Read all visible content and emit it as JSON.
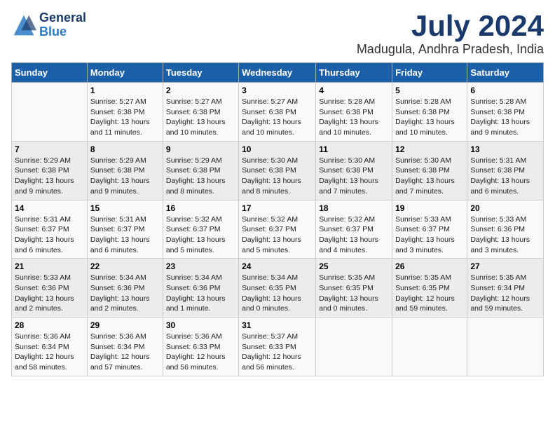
{
  "header": {
    "logo_line1": "General",
    "logo_line2": "Blue",
    "month": "July 2024",
    "location": "Madugula, Andhra Pradesh, India"
  },
  "columns": [
    "Sunday",
    "Monday",
    "Tuesday",
    "Wednesday",
    "Thursday",
    "Friday",
    "Saturday"
  ],
  "weeks": [
    [
      {
        "day": "",
        "info": ""
      },
      {
        "day": "1",
        "info": "Sunrise: 5:27 AM\nSunset: 6:38 PM\nDaylight: 13 hours\nand 11 minutes."
      },
      {
        "day": "2",
        "info": "Sunrise: 5:27 AM\nSunset: 6:38 PM\nDaylight: 13 hours\nand 10 minutes."
      },
      {
        "day": "3",
        "info": "Sunrise: 5:27 AM\nSunset: 6:38 PM\nDaylight: 13 hours\nand 10 minutes."
      },
      {
        "day": "4",
        "info": "Sunrise: 5:28 AM\nSunset: 6:38 PM\nDaylight: 13 hours\nand 10 minutes."
      },
      {
        "day": "5",
        "info": "Sunrise: 5:28 AM\nSunset: 6:38 PM\nDaylight: 13 hours\nand 10 minutes."
      },
      {
        "day": "6",
        "info": "Sunrise: 5:28 AM\nSunset: 6:38 PM\nDaylight: 13 hours\nand 9 minutes."
      }
    ],
    [
      {
        "day": "7",
        "info": "Sunrise: 5:29 AM\nSunset: 6:38 PM\nDaylight: 13 hours\nand 9 minutes."
      },
      {
        "day": "8",
        "info": "Sunrise: 5:29 AM\nSunset: 6:38 PM\nDaylight: 13 hours\nand 9 minutes."
      },
      {
        "day": "9",
        "info": "Sunrise: 5:29 AM\nSunset: 6:38 PM\nDaylight: 13 hours\nand 8 minutes."
      },
      {
        "day": "10",
        "info": "Sunrise: 5:30 AM\nSunset: 6:38 PM\nDaylight: 13 hours\nand 8 minutes."
      },
      {
        "day": "11",
        "info": "Sunrise: 5:30 AM\nSunset: 6:38 PM\nDaylight: 13 hours\nand 7 minutes."
      },
      {
        "day": "12",
        "info": "Sunrise: 5:30 AM\nSunset: 6:38 PM\nDaylight: 13 hours\nand 7 minutes."
      },
      {
        "day": "13",
        "info": "Sunrise: 5:31 AM\nSunset: 6:38 PM\nDaylight: 13 hours\nand 6 minutes."
      }
    ],
    [
      {
        "day": "14",
        "info": "Sunrise: 5:31 AM\nSunset: 6:37 PM\nDaylight: 13 hours\nand 6 minutes."
      },
      {
        "day": "15",
        "info": "Sunrise: 5:31 AM\nSunset: 6:37 PM\nDaylight: 13 hours\nand 6 minutes."
      },
      {
        "day": "16",
        "info": "Sunrise: 5:32 AM\nSunset: 6:37 PM\nDaylight: 13 hours\nand 5 minutes."
      },
      {
        "day": "17",
        "info": "Sunrise: 5:32 AM\nSunset: 6:37 PM\nDaylight: 13 hours\nand 5 minutes."
      },
      {
        "day": "18",
        "info": "Sunrise: 5:32 AM\nSunset: 6:37 PM\nDaylight: 13 hours\nand 4 minutes."
      },
      {
        "day": "19",
        "info": "Sunrise: 5:33 AM\nSunset: 6:37 PM\nDaylight: 13 hours\nand 3 minutes."
      },
      {
        "day": "20",
        "info": "Sunrise: 5:33 AM\nSunset: 6:36 PM\nDaylight: 13 hours\nand 3 minutes."
      }
    ],
    [
      {
        "day": "21",
        "info": "Sunrise: 5:33 AM\nSunset: 6:36 PM\nDaylight: 13 hours\nand 2 minutes."
      },
      {
        "day": "22",
        "info": "Sunrise: 5:34 AM\nSunset: 6:36 PM\nDaylight: 13 hours\nand 2 minutes."
      },
      {
        "day": "23",
        "info": "Sunrise: 5:34 AM\nSunset: 6:36 PM\nDaylight: 13 hours\nand 1 minute."
      },
      {
        "day": "24",
        "info": "Sunrise: 5:34 AM\nSunset: 6:35 PM\nDaylight: 13 hours\nand 0 minutes."
      },
      {
        "day": "25",
        "info": "Sunrise: 5:35 AM\nSunset: 6:35 PM\nDaylight: 13 hours\nand 0 minutes."
      },
      {
        "day": "26",
        "info": "Sunrise: 5:35 AM\nSunset: 6:35 PM\nDaylight: 12 hours\nand 59 minutes."
      },
      {
        "day": "27",
        "info": "Sunrise: 5:35 AM\nSunset: 6:34 PM\nDaylight: 12 hours\nand 59 minutes."
      }
    ],
    [
      {
        "day": "28",
        "info": "Sunrise: 5:36 AM\nSunset: 6:34 PM\nDaylight: 12 hours\nand 58 minutes."
      },
      {
        "day": "29",
        "info": "Sunrise: 5:36 AM\nSunset: 6:34 PM\nDaylight: 12 hours\nand 57 minutes."
      },
      {
        "day": "30",
        "info": "Sunrise: 5:36 AM\nSunset: 6:33 PM\nDaylight: 12 hours\nand 56 minutes."
      },
      {
        "day": "31",
        "info": "Sunrise: 5:37 AM\nSunset: 6:33 PM\nDaylight: 12 hours\nand 56 minutes."
      },
      {
        "day": "",
        "info": ""
      },
      {
        "day": "",
        "info": ""
      },
      {
        "day": "",
        "info": ""
      }
    ]
  ]
}
